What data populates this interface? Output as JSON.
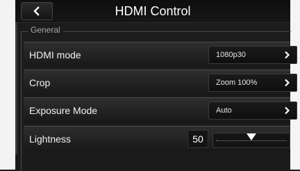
{
  "header": {
    "title": "HDMI Control",
    "back_icon": "chevron-left-icon"
  },
  "group": {
    "label": "General"
  },
  "rows": [
    {
      "label": "HDMI mode",
      "value": "1080p30",
      "icon": "chevron-right-icon"
    },
    {
      "label": "Crop",
      "value": "Zoom 100%",
      "icon": "chevron-right-icon"
    },
    {
      "label": "Exposure Mode",
      "value": "Auto",
      "icon": "chevron-right-icon"
    }
  ],
  "lightness": {
    "label": "Lightness",
    "value": "50",
    "level_fraction": 0.5
  },
  "colors": {
    "background": "#1c1c1c",
    "text": "#f2f2f2",
    "bezel": "#f4f4f4"
  }
}
